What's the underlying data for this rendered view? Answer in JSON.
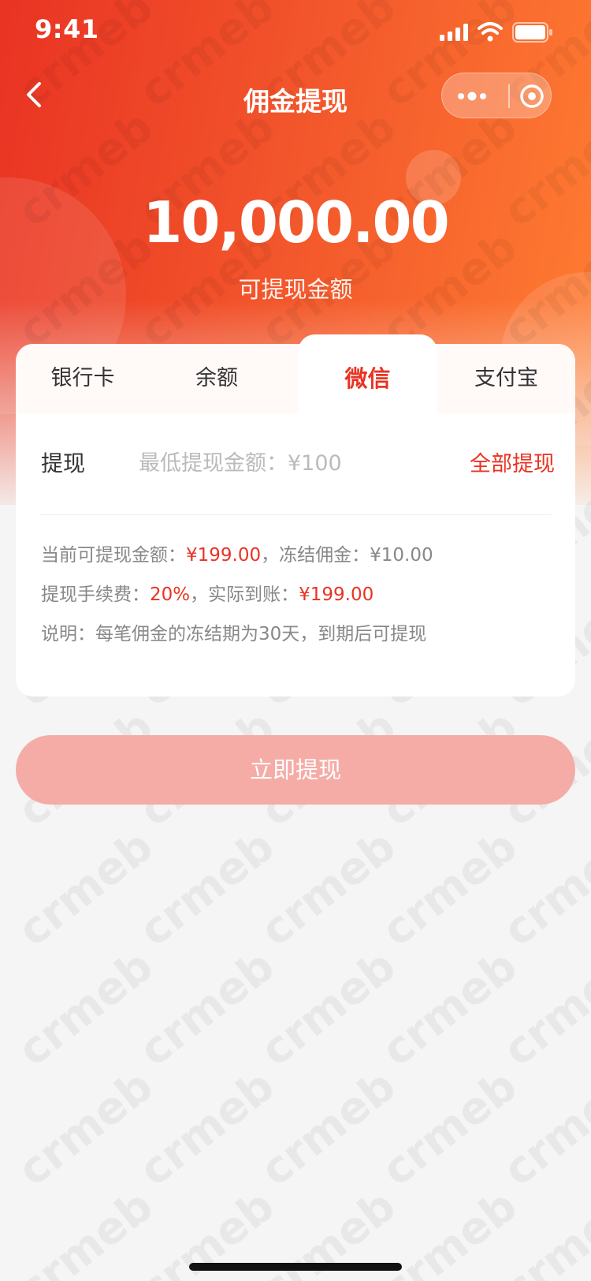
{
  "status_bar": {
    "time": "9:41"
  },
  "nav": {
    "title": "佣金提现"
  },
  "balance": {
    "amount": "10,000.00",
    "label": "可提现金额"
  },
  "tabs": [
    {
      "label": "银行卡",
      "active": false
    },
    {
      "label": "余额",
      "active": false
    },
    {
      "label": "微信",
      "active": true
    },
    {
      "label": "支付宝",
      "active": false
    }
  ],
  "withdraw": {
    "label": "提现",
    "placeholder": "最低提现金额：¥100",
    "value": "",
    "all_label": "全部提现"
  },
  "info": {
    "current_label": "当前可提现金额：",
    "current_value": "¥199.00",
    "frozen_text": "，冻结佣金：¥10.00",
    "fee_label": "提现手续费：",
    "fee_value": "20%",
    "actual_label": "，实际到账：",
    "actual_value": "¥199.00",
    "note": "说明：每笔佣金的冻结期为30天，到期后可提现"
  },
  "submit_label": "立即提现",
  "watermark_text": "crmeb",
  "colors": {
    "accent": "#e93323",
    "gradient_end": "#ff7e32",
    "button_disabled": "#f5aca6"
  }
}
